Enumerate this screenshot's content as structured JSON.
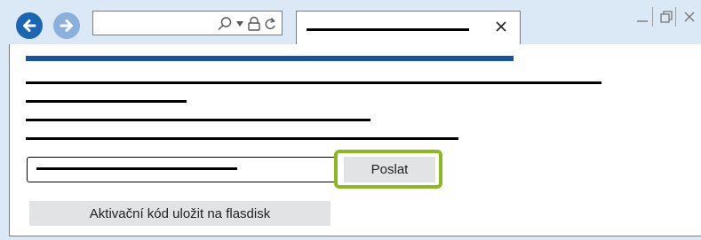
{
  "browser": {
    "back_icon": "arrow-left-icon",
    "forward_icon": "arrow-right-icon",
    "address_icons": [
      "search-icon",
      "dropdown-icon",
      "lock-icon",
      "refresh-icon"
    ],
    "tab_close_icon": "close-icon",
    "window_controls": [
      "minimize-icon",
      "maximize-icon",
      "close-icon"
    ]
  },
  "page": {
    "send_button_label": "Poslat",
    "save_usb_button_label": "Aktivační kód uložit na flasdisk"
  },
  "colors": {
    "accent_blue": "#1554a5",
    "highlight_green": "#8cb91f",
    "button_gray": "#e1e3e5",
    "chrome_bg": "#dbe9f6"
  }
}
